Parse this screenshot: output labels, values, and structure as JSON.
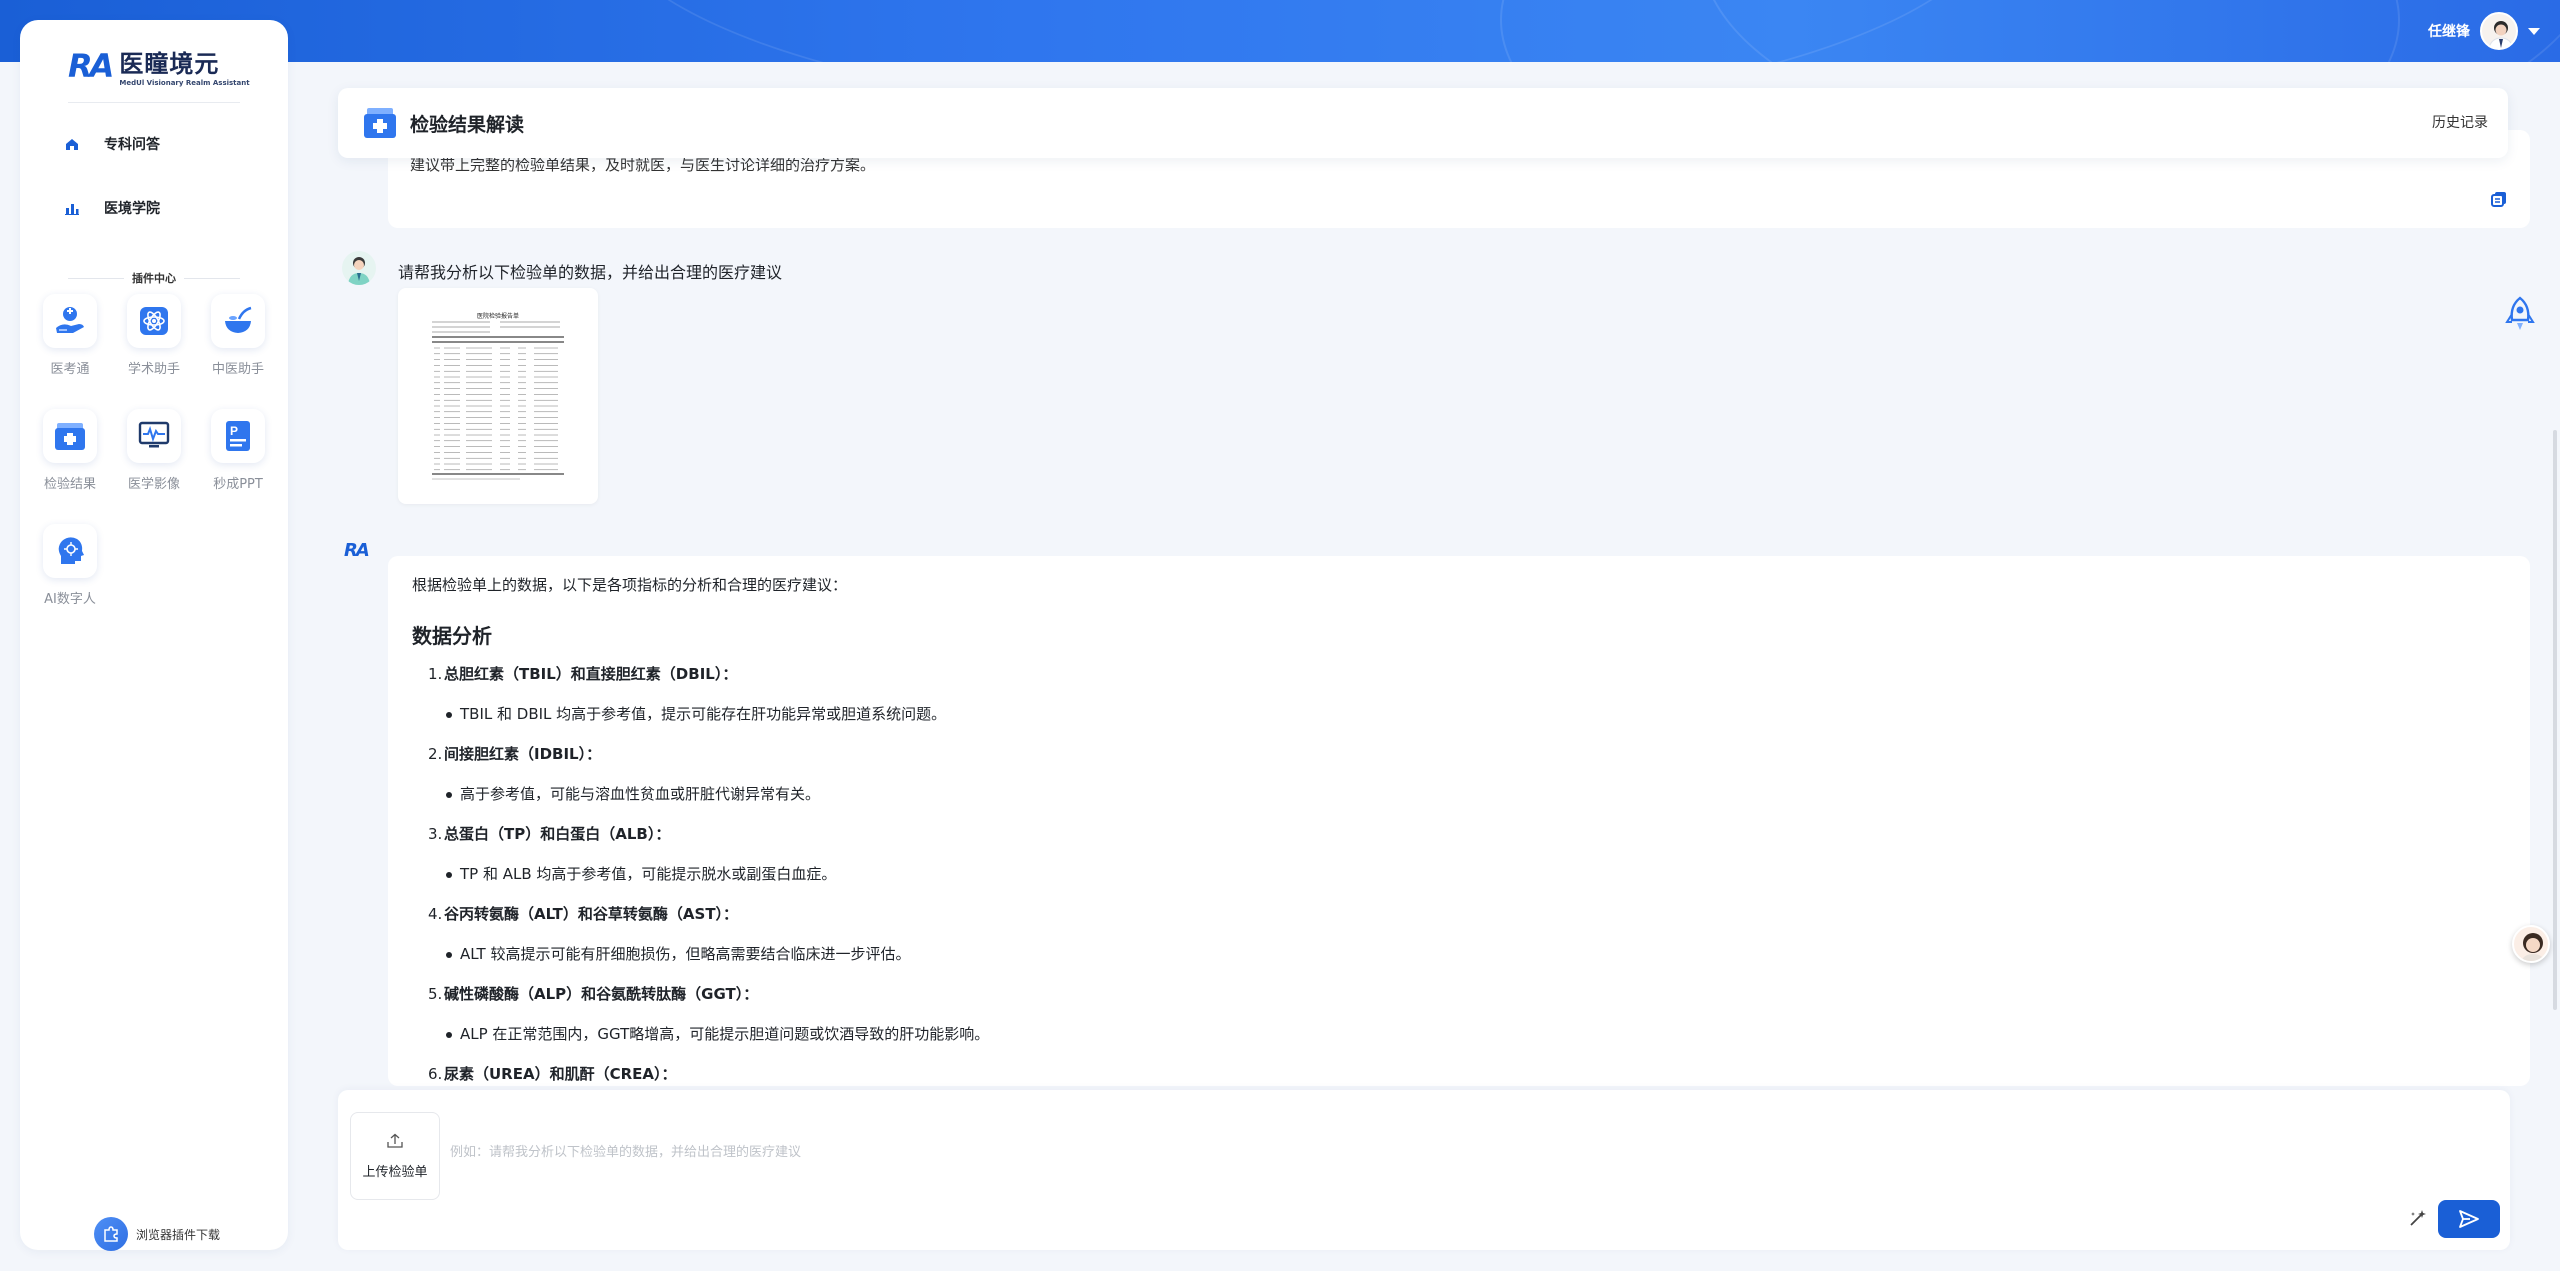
{
  "header": {
    "user_name": "任继锋"
  },
  "sidebar": {
    "logo_mark": "RA",
    "brand_name": "医瞳境元",
    "brand_sub": "MedUl Visionary Realm Assistant",
    "nav": [
      {
        "label": "专科问答",
        "icon": "home-icon"
      },
      {
        "label": "医境学院",
        "icon": "bar-chart-icon"
      }
    ],
    "plugin_center": "插件中心",
    "tools": [
      {
        "label": "医考通",
        "icon": "doctor-exam-icon"
      },
      {
        "label": "学术助手",
        "icon": "atom-icon"
      },
      {
        "label": "中医助手",
        "icon": "herb-bowl-icon"
      },
      {
        "label": "检验结果",
        "icon": "medical-kit-icon"
      },
      {
        "label": "医学影像",
        "icon": "monitor-pulse-icon"
      },
      {
        "label": "秒成PPT",
        "icon": "ppt-icon"
      },
      {
        "label": "AI数字人",
        "icon": "ai-head-icon"
      }
    ],
    "download_label": "浏览器插件下载"
  },
  "main": {
    "title": "检验结果解读",
    "history": "历史记录",
    "prev_answer_tail": "建议带上完整的检验单结果，及时就医，与医生讨论详细的治疗方案。",
    "user_message": "请帮我分析以下检验单的数据，并给出合理的医疗建议",
    "report_title": "医院检验报告单",
    "answer": {
      "intro": "根据检验单上的数据，以下是各项指标的分析和合理的医疗建议：",
      "section": "数据分析",
      "items": [
        {
          "num": "1.",
          "title": "总胆红素（TBIL）和直接胆红素（DBIL）：",
          "detail": "TBIL 和 DBIL 均高于参考值，提示可能存在肝功能异常或胆道系统问题。"
        },
        {
          "num": "2.",
          "title": "间接胆红素（IDBIL）：",
          "detail": "高于参考值，可能与溶血性贫血或肝脏代谢异常有关。"
        },
        {
          "num": "3.",
          "title": "总蛋白（TP）和白蛋白（ALB）：",
          "detail": "TP 和 ALB 均高于参考值，可能提示脱水或副蛋白血症。"
        },
        {
          "num": "4.",
          "title": "谷丙转氨酶（ALT）和谷草转氨酶（AST）：",
          "detail": "ALT 较高提示可能有肝细胞损伤，但略高需要结合临床进一步评估。"
        },
        {
          "num": "5.",
          "title": "碱性磷酸酶（ALP）和谷氨酰转肽酶（GGT）：",
          "detail": "ALP 在正常范围内，GGT略增高，可能提示胆道问题或饮酒导致的肝功能影响。"
        },
        {
          "num": "6.",
          "title": "尿素（UREA）和肌酐（CREA）：",
          "detail": ""
        }
      ]
    }
  },
  "input": {
    "upload_label": "上传检验单",
    "placeholder": "例如：请帮我分析以下检验单的数据，并给出合理的医疗建议"
  },
  "colors": {
    "brand": "#1a5fd6",
    "banner": "#2f76ee",
    "bg": "#f3f6fb"
  }
}
